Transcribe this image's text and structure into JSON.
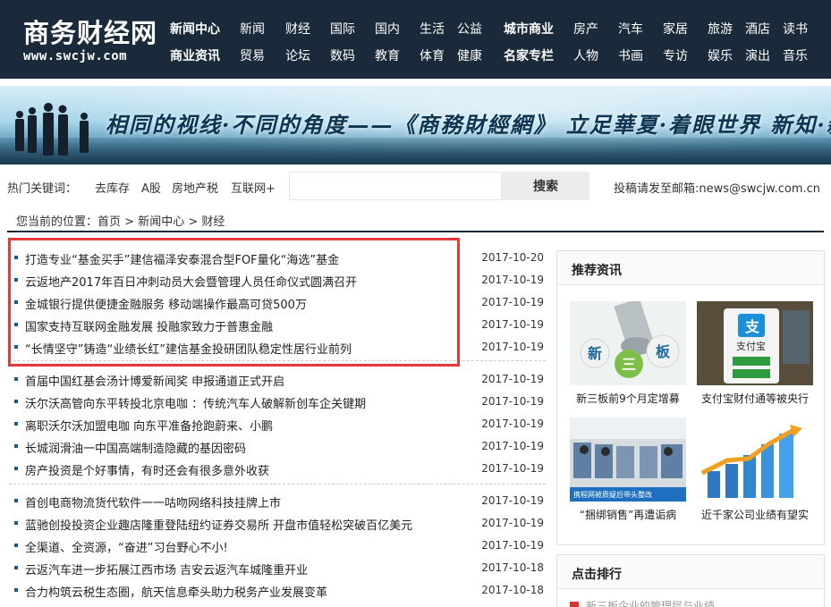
{
  "site": {
    "logo_cn": "商务财经网",
    "logo_en": "www.swcjw.com"
  },
  "nav": {
    "row1": [
      "新闻中心",
      "新闻",
      "财经",
      "国际",
      "国内",
      "生活",
      "公益",
      "城市商业",
      "房产",
      "汽车",
      "家居",
      "旅游",
      "酒店",
      "读书"
    ],
    "row2": [
      "商业资讯",
      "贸易",
      "论坛",
      "数码",
      "教育",
      "体育",
      "健康",
      "名家专栏",
      "人物",
      "书画",
      "专访",
      "娱乐",
      "演出",
      "音乐"
    ]
  },
  "banner": {
    "slogan": "相同的视线·不同的角度——《商務財經網》 立足華夏·着眼世界 新知·新锐"
  },
  "search": {
    "hot_label": "热门关键词：",
    "keywords": [
      "去库存",
      "A股",
      "房地产税",
      "互联网+"
    ],
    "placeholder": "",
    "button": "搜索",
    "contribute": "投稿请发至邮箱:news@swcjw.com.cn"
  },
  "breadcrumb": {
    "prefix": "您当前的位置：",
    "home": "首页",
    "sep": ">",
    "section": "新闻中心",
    "current": "财经"
  },
  "articles": {
    "group1": [
      {
        "title": "打造专业“基金买手”建信福泽安泰混合型FOF量化“海选”基金",
        "date": "2017-10-20"
      },
      {
        "title": "云返地产2017年百日冲刺动员大会暨管理人员任命仪式圆满召开",
        "date": "2017-10-19"
      },
      {
        "title": "金城银行提供便捷金融服务 移动端操作最高可贷500万",
        "date": "2017-10-19"
      },
      {
        "title": "国家支持互联网金融发展 投融家致力于普惠金融",
        "date": "2017-10-19"
      },
      {
        "title": "“长情坚守”铸造“业绩长红”建信基金投研团队稳定性居行业前列",
        "date": "2017-10-19"
      }
    ],
    "group2": [
      {
        "title": "首届中国红基会汤计博爱新闻奖 申报通道正式开启",
        "date": "2017-10-19"
      },
      {
        "title": "沃尔沃高管向东平转投北京电咖 ：传统汽车人破解新创车企关键期",
        "date": "2017-10-19"
      },
      {
        "title": "离职沃尔沃加盟电咖 向东平准备抢跑蔚来、小鹏",
        "date": "2017-10-19"
      },
      {
        "title": "长城润滑油一中国高端制造隐藏的基因密码",
        "date": "2017-10-19"
      },
      {
        "title": "房产投资是个好事情，有时还会有很多意外收获",
        "date": "2017-10-19"
      }
    ],
    "group3": [
      {
        "title": "首创电商物流货代软件一一咕吻网络科技挂牌上市",
        "date": "2017-10-19"
      },
      {
        "title": "蓝驰创投投资企业趣店隆重登陆纽约证券交易所 开盘市值轻松突破百亿美元",
        "date": "2017-10-19"
      },
      {
        "title": "全渠道、全资源，“奋进”习台野心不小!",
        "date": "2017-10-19"
      },
      {
        "title": "云返汽车进一步拓展江西市场 吉安云返汽车城隆重开业",
        "date": "2017-10-18"
      },
      {
        "title": "合力构筑云税生态圈，航天信息牵头助力税务产业发展变革",
        "date": "2017-10-18"
      }
    ]
  },
  "sidebar": {
    "recommend_title": "推荐资讯",
    "items": [
      {
        "caption": "新三板前9个月定增募",
        "image_text": "新三板"
      },
      {
        "caption": "支付宝财付通等被央行",
        "image_text": "支付宝"
      },
      {
        "caption": "“捆绑销售”再遭诟病",
        "image_text": "携程网被质疑后带头整改"
      },
      {
        "caption": "近千家公司业绩有望实",
        "image_text": ""
      }
    ],
    "rank_title": "点击排行",
    "rank_peek": "新三板企业的管理层与业绩"
  },
  "colors": {
    "header_bg": "#1b2a3a",
    "highlight_border": "#e8373a"
  }
}
